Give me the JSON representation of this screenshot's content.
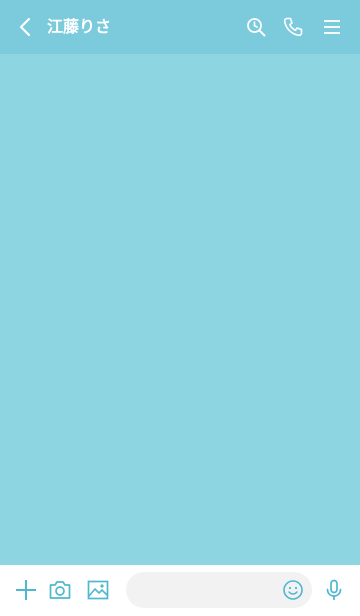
{
  "header": {
    "title": "江藤りさ",
    "icons": [
      "back-icon",
      "search-clock-icon",
      "phone-icon",
      "menu-icon"
    ]
  },
  "composer": {
    "input_value": "",
    "input_placeholder": "",
    "icons": [
      "plus-icon",
      "camera-icon",
      "image-icon",
      "emoji-icon",
      "microphone-icon"
    ]
  },
  "colors": {
    "header_bg": "#7ccbdd",
    "chat_bg": "#8ed5e2",
    "icon_color": "#4fb7cf",
    "footer_bg": "#ffffff"
  }
}
